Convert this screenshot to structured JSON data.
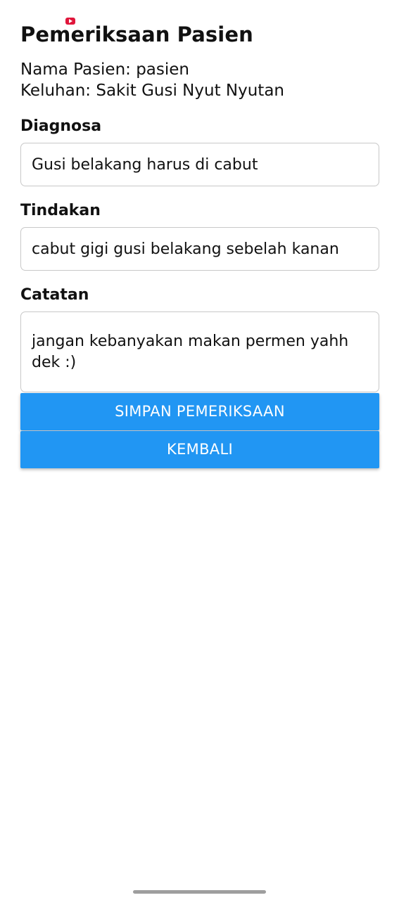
{
  "status": {
    "recording_icon": "screen-record-icon",
    "recording_color": "#e0163b"
  },
  "page": {
    "title": "Pemeriksaan Pasien"
  },
  "patient": {
    "name_line": "Nama Pasien: pasien",
    "complaint_line": "Keluhan: Sakit Gusi Nyut Nyutan"
  },
  "form": {
    "diagnosa": {
      "label": "Diagnosa",
      "value": "Gusi belakang harus di cabut"
    },
    "tindakan": {
      "label": "Tindakan",
      "value": "cabut gigi gusi belakang sebelah kanan"
    },
    "catatan": {
      "label": "Catatan",
      "value": "jangan kebanyakan makan permen yahh dek :)"
    }
  },
  "buttons": {
    "save_label": "SIMPAN PEMERIKSAAN",
    "back_label": "KEMBALI"
  },
  "colors": {
    "button_primary": "#2196f3",
    "input_border": "#c8c8c8"
  }
}
